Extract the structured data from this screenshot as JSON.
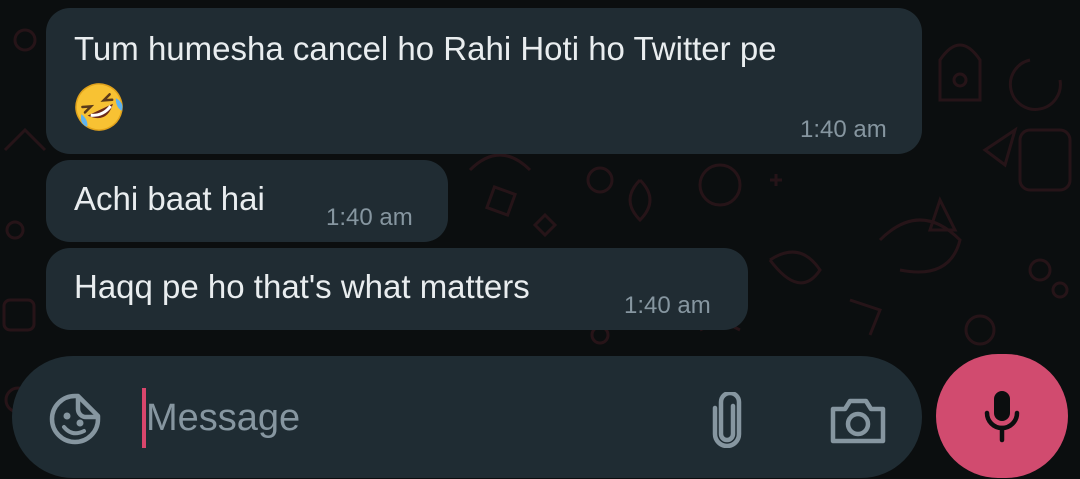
{
  "messages": [
    {
      "text": "Tum humesha cancel ho Rahi Hoti ho Twitter pe",
      "emoji": "rolling-on-floor-laughing-emoji",
      "time": "1:40 am"
    },
    {
      "text": "Achi baat hai",
      "time": "1:40 am"
    },
    {
      "text": "Haqq pe ho that's what matters",
      "time": "1:40 am"
    }
  ],
  "composer": {
    "placeholder": "Message",
    "value": "",
    "icons": {
      "sticker": "sticker-icon",
      "attach": "paperclip-icon",
      "camera": "camera-icon",
      "mic": "microphone-icon"
    }
  },
  "colors": {
    "background": "#0b0e0f",
    "bubble": "#202c33",
    "text": "#e9edef",
    "timestamp": "#8696a0",
    "mic_button": "#d14b6f",
    "cursor": "#d9466c"
  }
}
